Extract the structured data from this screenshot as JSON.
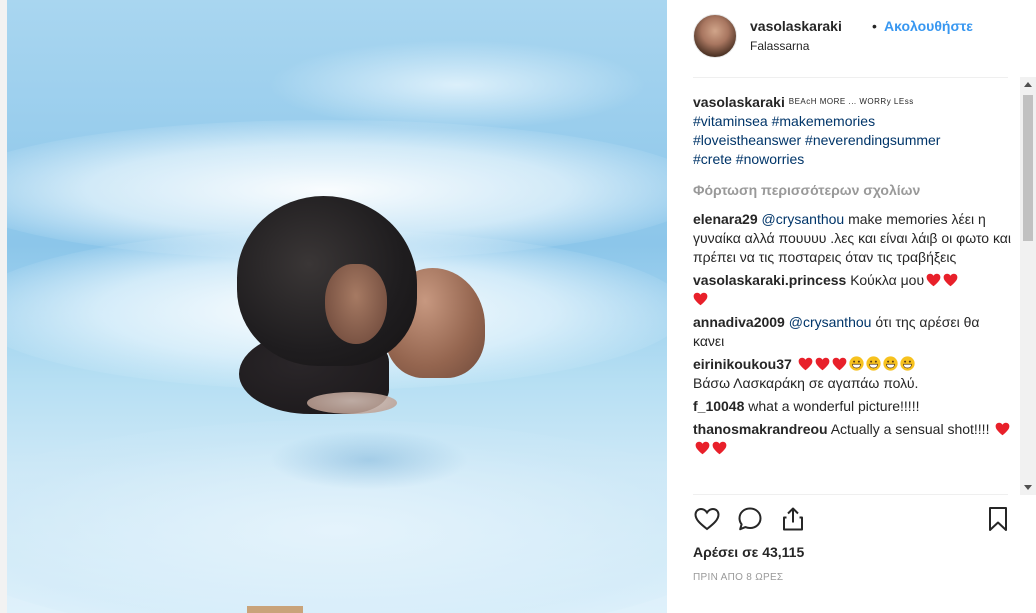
{
  "post": {
    "username": "vasolaskaraki",
    "dot": "•",
    "follow_label": "Ακολουθήστε",
    "location": "Falassarna",
    "likes_label": "Αρέσει σε 43,115",
    "time_label": "ΠΡΙΝ ΑΠΟ 8 ΩΡΕΣ"
  },
  "caption": {
    "username": "vasolaskaraki",
    "styled_text": "BEAcH MORE ... WORRy LEss",
    "hashtags_line1": "#vitaminsea #makememories",
    "hashtags_line2": "#loveistheanswer #neverendingsummer",
    "hashtags_line3": "#crete #noworries"
  },
  "load_more_label": "Φόρτωση περισσότερων σχολίων",
  "comments": [
    {
      "username": "elenara29",
      "mention": "@crysanthou",
      "text": " make memories λέει η γυναίκα αλλά πουυυυ .λες και είναι λάιβ οι φωτο και πρέπει να τις ποσταρεις όταν τις τραβήξεις"
    },
    {
      "username": "vasolaskaraki.princess",
      "text": " Κούκλα μου"
    },
    {
      "username": "annadiva2009",
      "mention": "@crysanthou",
      "text": " ότι της αρέσει θα κανει"
    },
    {
      "username": "eirinikoukou37",
      "text": "Βάσω Λασκαράκη σε αγαπάω πολύ."
    },
    {
      "username": "f_10048",
      "text": " what a wonderful picture!!!!!"
    },
    {
      "username": "thanosmakrandreou",
      "text": " Actually a sensual shot!!!! "
    }
  ],
  "icons": {
    "like": "heart-outline-icon",
    "comment": "comment-bubble-icon",
    "share": "share-icon",
    "save": "bookmark-icon"
  },
  "colors": {
    "link_blue": "#3897f0",
    "hashtag_navy": "#003569",
    "muted_gray": "#999999",
    "emoji_heart": "#e8202a",
    "emoji_face": "#f7c21e"
  }
}
